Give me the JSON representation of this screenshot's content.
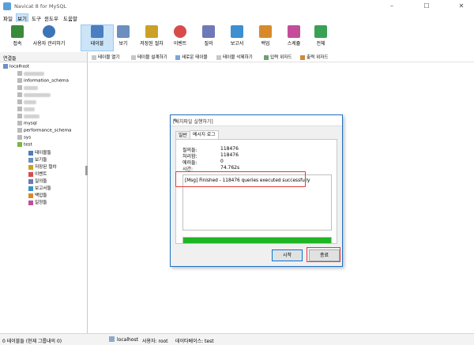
{
  "window": {
    "title": "Navicat 8 for MySQL",
    "minimize": "–",
    "maximize": "☐",
    "close": "✕"
  },
  "menu": [
    "파일",
    "보기",
    "도구",
    "윈도우",
    "도움말"
  ],
  "toolbar": [
    {
      "label": "접속",
      "icon": "plug-icon",
      "color": "#3a8a3a"
    },
    {
      "label": "사용자 관리하기",
      "icon": "user-icon",
      "color": "#3d74b8"
    },
    {
      "label": "테이블",
      "icon": "table-icon",
      "color": "#4a7ec0"
    },
    {
      "label": "보기",
      "icon": "view-icon",
      "color": "#6b8fbf"
    },
    {
      "label": "저장된 절차",
      "icon": "procedure-icon",
      "color": "#c9a227"
    },
    {
      "label": "이벤트",
      "icon": "event-icon",
      "color": "#d94b4b"
    },
    {
      "label": "질의",
      "icon": "query-icon",
      "color": "#6f79b9"
    },
    {
      "label": "보고서",
      "icon": "report-icon",
      "color": "#3d8fd1"
    },
    {
      "label": "백업",
      "icon": "backup-icon",
      "color": "#d88a2a"
    },
    {
      "label": "스케쥴",
      "icon": "schedule-icon",
      "color": "#c44d9a"
    },
    {
      "label": "전체",
      "icon": "model-icon",
      "color": "#3aa055"
    }
  ],
  "sidebar": {
    "header": "연결들",
    "connection": "localhost",
    "databases": [
      {
        "name": "",
        "blurred": true
      },
      {
        "name": "information_schema",
        "blurred": false
      },
      {
        "name": "",
        "blurred": true
      },
      {
        "name": "",
        "blurred": true
      },
      {
        "name": "",
        "blurred": true
      },
      {
        "name": "",
        "blurred": true
      },
      {
        "name": "",
        "blurred": true
      },
      {
        "name": "mysql",
        "blurred": false
      },
      {
        "name": "performance_schema",
        "blurred": false
      },
      {
        "name": "sys",
        "blurred": false
      }
    ],
    "open_database": "test",
    "objects": [
      "테이블들",
      "보기들",
      "저장된 절차",
      "이벤트",
      "질의들",
      "보고서들",
      "백업들",
      "일정들"
    ]
  },
  "object_toolbar": [
    "테이블 열기",
    "테이블 설계하기",
    "새로운 테이블",
    "테이블 삭제하기",
    "입력 위자드",
    "출력 위자드"
  ],
  "dialog": {
    "title": "[배치파일 실행하기]",
    "close": "✕",
    "tabs": [
      "일반",
      "메시지 로그"
    ],
    "stats": [
      {
        "label": "질의들:",
        "value": "118476"
      },
      {
        "label": "처리함:",
        "value": "118476"
      },
      {
        "label": "에러들:",
        "value": "0"
      },
      {
        "label": "시간:",
        "value": "74.762s"
      }
    ],
    "log": "[Msg] Finished - 118476 queries executed successfully",
    "progress": 100,
    "start_label": "시작",
    "close_label": "종료"
  },
  "status": {
    "left": "0 테이블들 (현재 그룹내의 0)",
    "host": "localhost",
    "user": "사용자: root",
    "database": "데이타베이스: test"
  }
}
